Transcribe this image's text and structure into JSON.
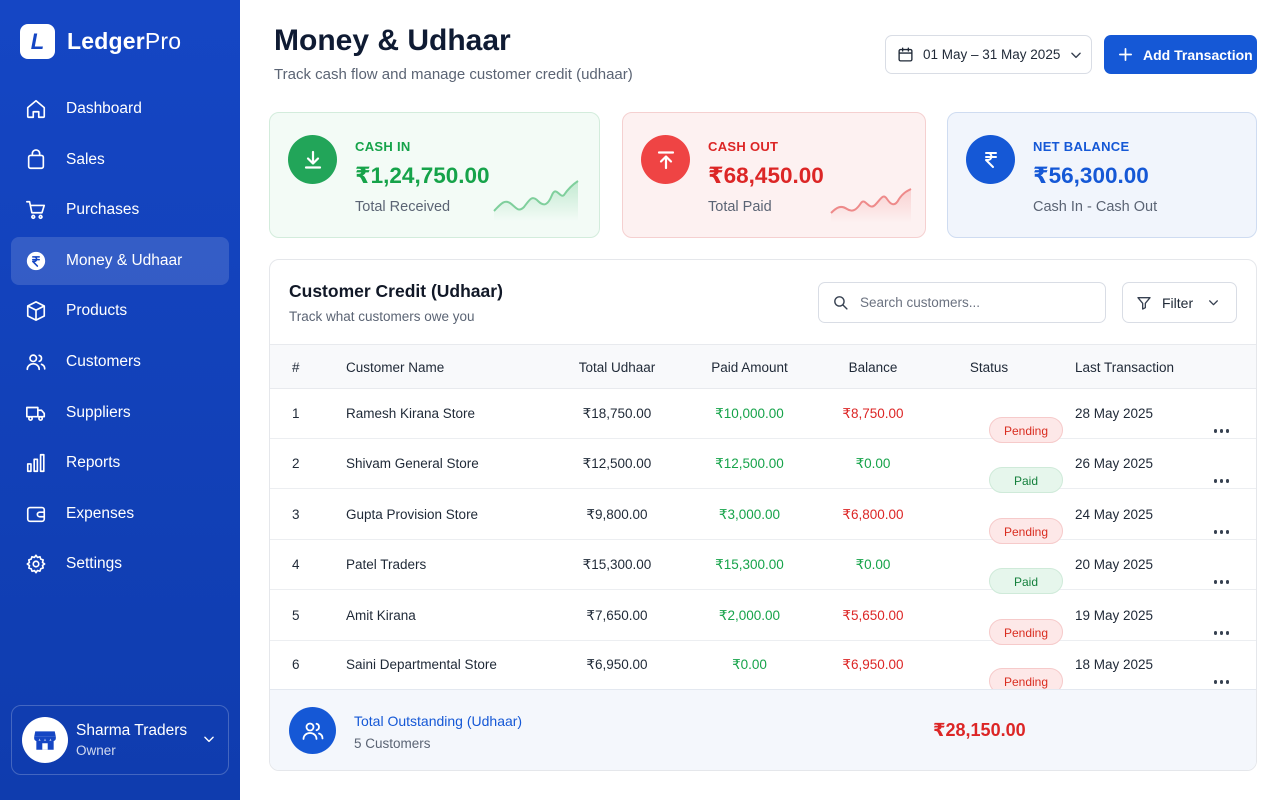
{
  "brand": {
    "name_bold": "Ledger",
    "name_light": "Pro",
    "logo_letter": "L"
  },
  "sidebar": {
    "items": [
      {
        "label": "Dashboard",
        "icon": "home-icon"
      },
      {
        "label": "Sales",
        "icon": "shopping-bag-icon"
      },
      {
        "label": "Purchases",
        "icon": "cart-icon"
      },
      {
        "label": "Money & Udhaar",
        "icon": "rupee-icon",
        "active": true
      },
      {
        "label": "Products",
        "icon": "box-icon"
      },
      {
        "label": "Customers",
        "icon": "users-icon"
      },
      {
        "label": "Suppliers",
        "icon": "truck-icon"
      },
      {
        "label": "Reports",
        "icon": "bar-chart-icon"
      },
      {
        "label": "Expenses",
        "icon": "wallet-icon"
      },
      {
        "label": "Settings",
        "icon": "gear-icon"
      }
    ],
    "user": {
      "name": "Sharma Traders",
      "role": "Owner"
    }
  },
  "header": {
    "title": "Money & Udhaar",
    "subtitle": "Track cash flow and manage customer credit (udhaar)",
    "date_range": "01 May – 31 May 2025",
    "add_button": "Add Transaction"
  },
  "stats": {
    "cash_in": {
      "label": "CASH IN",
      "value": "₹1,24,750.00",
      "sub": "Total Received",
      "color": "#16a34a"
    },
    "cash_out": {
      "label": "CASH OUT",
      "value": "₹68,450.00",
      "sub": "Total Paid",
      "color": "#dc2626"
    },
    "net": {
      "label": "NET BALANCE",
      "value": "₹56,300.00",
      "sub": "Cash In - Cash Out",
      "color": "#1558d6"
    }
  },
  "credit": {
    "title": "Customer Credit (Udhaar)",
    "subtitle": "Track what customers owe you",
    "search_placeholder": "Search customers...",
    "filter_label": "Filter",
    "columns": {
      "num": "#",
      "name": "Customer Name",
      "total": "Total Udhaar",
      "paid": "Paid Amount",
      "balance": "Balance",
      "status": "Status",
      "last": "Last Transaction"
    },
    "rows": [
      {
        "num": "1",
        "name": "Ramesh Kirana Store",
        "total": "₹18,750.00",
        "paid": "₹10,000.00",
        "balance": "₹8,750.00",
        "status": "Pending",
        "last": "28 May 2025"
      },
      {
        "num": "2",
        "name": "Shivam General Store",
        "total": "₹12,500.00",
        "paid": "₹12,500.00",
        "balance": "₹0.00",
        "status": "Paid",
        "last": "26 May 2025"
      },
      {
        "num": "3",
        "name": "Gupta Provision Store",
        "total": "₹9,800.00",
        "paid": "₹3,000.00",
        "balance": "₹6,800.00",
        "status": "Pending",
        "last": "24 May 2025"
      },
      {
        "num": "4",
        "name": "Patel Traders",
        "total": "₹15,300.00",
        "paid": "₹15,300.00",
        "balance": "₹0.00",
        "status": "Paid",
        "last": "20 May 2025"
      },
      {
        "num": "5",
        "name": "Amit Kirana",
        "total": "₹7,650.00",
        "paid": "₹2,000.00",
        "balance": "₹5,650.00",
        "status": "Pending",
        "last": "19 May 2025"
      },
      {
        "num": "6",
        "name": "Saini Departmental Store",
        "total": "₹6,950.00",
        "paid": "₹0.00",
        "balance": "₹6,950.00",
        "status": "Pending",
        "last": "18 May 2025"
      }
    ],
    "footer": {
      "title": "Total Outstanding (Udhaar)",
      "sub": "5 Customers",
      "amount": "₹28,150.00"
    }
  }
}
